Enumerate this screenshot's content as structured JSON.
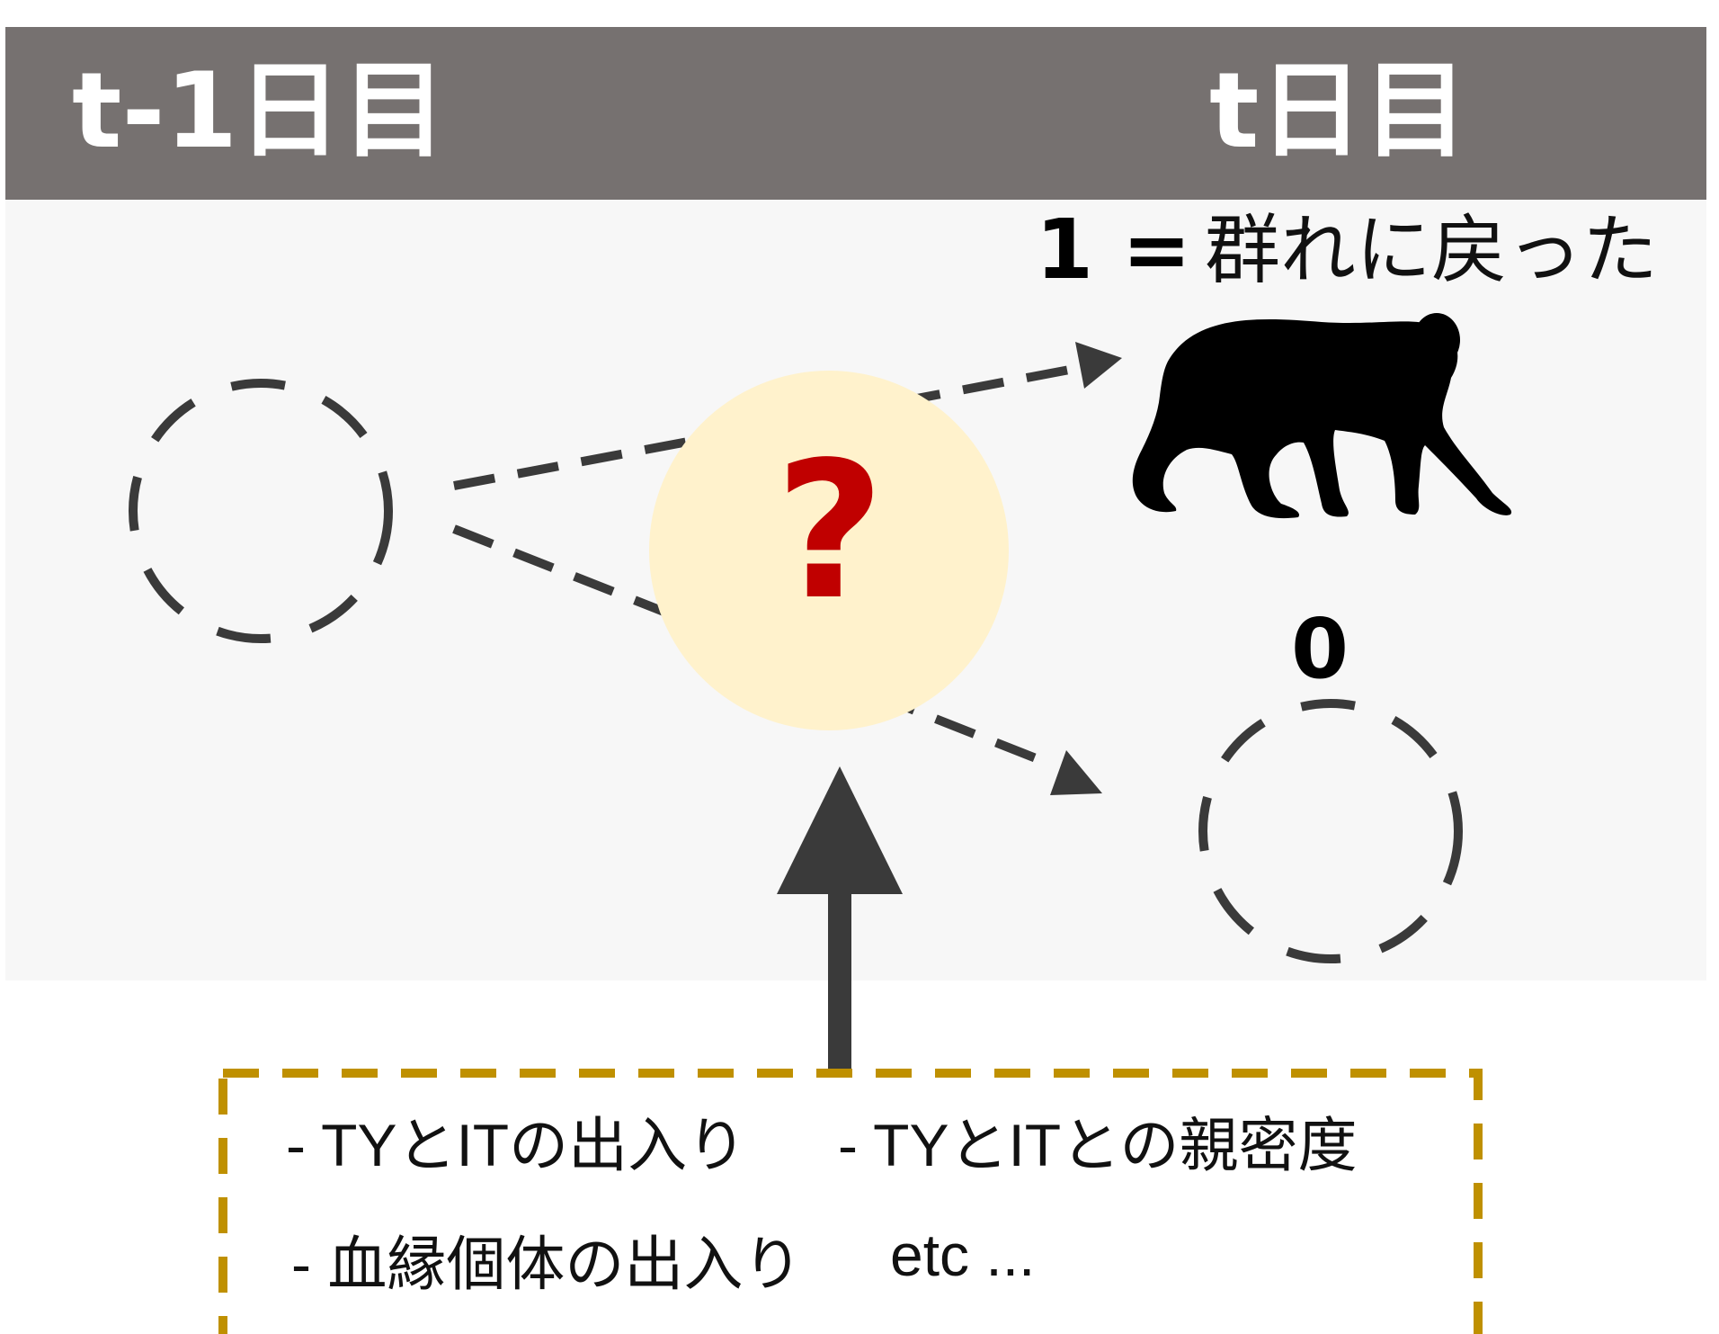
{
  "header": {
    "previous_day": "t-1日目",
    "current_day": "t日目"
  },
  "outcomes": {
    "returned_value": "1 =",
    "returned_label": "群れに戻った",
    "absent_value": "0"
  },
  "question": {
    "mark": "?"
  },
  "factors": {
    "items": [
      "- TYとITの出入り",
      "- TYとITとの親密度",
      "- 血縁個体の出入り",
      "etc ..."
    ]
  },
  "colors": {
    "header_bg": "#767170",
    "stage_bg": "#f7f7f7",
    "question_circle": "#fff2cc",
    "question_mark": "#c00000",
    "factor_box_border": "#bf9000",
    "arrow": "#3a3a3a"
  },
  "icons": {
    "monkey": "monkey-silhouette-icon"
  }
}
